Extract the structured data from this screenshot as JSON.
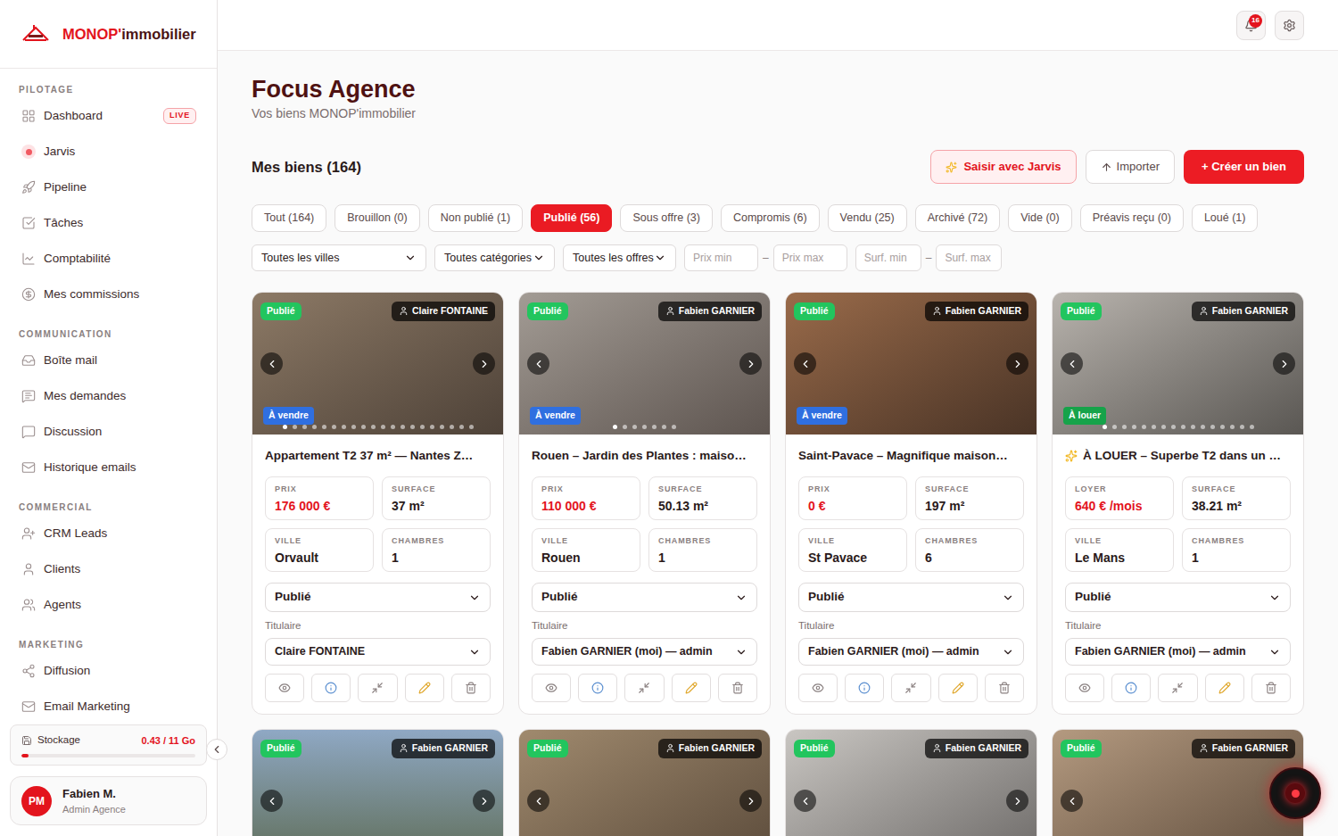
{
  "sidebar": {
    "logo": {
      "brand": "MONOP'",
      "suffix": "immobilier"
    },
    "sections": [
      {
        "label": "PILOTAGE",
        "items": [
          {
            "label": "Dashboard",
            "badge": "LIVE",
            "selected": false
          },
          {
            "label": "Jarvis",
            "badge": "",
            "selected": false
          },
          {
            "label": "Pipeline",
            "badge": "",
            "selected": false
          },
          {
            "label": "Tâches",
            "badge": "",
            "selected": false
          },
          {
            "label": "Comptabilité",
            "badge": "",
            "selected": false
          },
          {
            "label": "Mes commissions",
            "badge": "",
            "selected": false
          }
        ]
      },
      {
        "label": "COMMUNICATION",
        "items": [
          {
            "label": "Boîte mail",
            "badge": "",
            "selected": false
          },
          {
            "label": "Mes demandes",
            "badge": "",
            "selected": false
          },
          {
            "label": "Discussion",
            "badge": "",
            "selected": false
          },
          {
            "label": "Historique emails",
            "badge": "",
            "selected": false
          }
        ]
      },
      {
        "label": "COMMERCIAL",
        "items": [
          {
            "label": "CRM Leads",
            "badge": "",
            "selected": false
          },
          {
            "label": "Clients",
            "badge": "",
            "selected": false
          },
          {
            "label": "Agents",
            "badge": "",
            "selected": false
          }
        ]
      },
      {
        "label": "MARKETING",
        "items": [
          {
            "label": "Diffusion",
            "badge": "",
            "selected": false
          },
          {
            "label": "Email Marketing",
            "badge": "",
            "selected": false
          }
        ]
      }
    ],
    "storage": {
      "label": "Stockage",
      "reading": "0.43 / 11 Go",
      "level": 0.04
    },
    "user": {
      "initials": "PM",
      "name": "Fabien M.",
      "role": "Admin Agence"
    }
  },
  "topbar": {
    "notifications": "16"
  },
  "page": {
    "title": "Focus Agence",
    "subtitle": "Vos biens MONOP'immobilier"
  },
  "listing": {
    "heading": "Mes biens (164)",
    "actions": [
      {
        "label": "Saisir avec Jarvis",
        "kind": "jarvis"
      },
      {
        "label": "Importer",
        "kind": "import"
      },
      {
        "label": "+ Créer un bien",
        "kind": "create"
      }
    ]
  },
  "tabs": [
    {
      "label": "Tout (164)",
      "selected": false
    },
    {
      "label": "Brouillon (0)",
      "selected": false
    },
    {
      "label": "Non publié (1)",
      "selected": false
    },
    {
      "label": "Publié (56)",
      "selected": true
    },
    {
      "label": "Sous offre (3)",
      "selected": false
    },
    {
      "label": "Compromis (6)",
      "selected": false
    },
    {
      "label": "Vendu (25)",
      "selected": false
    },
    {
      "label": "Archivé (72)",
      "selected": false
    },
    {
      "label": "Vide (0)",
      "selected": false
    },
    {
      "label": "Préavis reçu (0)",
      "selected": false
    },
    {
      "label": "Loué (1)",
      "selected": false
    }
  ],
  "filters": {
    "selects": [
      "Toutes les villes",
      "Toutes catégories",
      "Toutes les offres"
    ],
    "ranges": [
      {
        "min": "Prix min",
        "separator": "–",
        "max": "Prix max"
      },
      {
        "min": "Surf. min",
        "separator": "–",
        "max": "Surf. max"
      }
    ]
  },
  "cards": [
    {
      "status": "Publié",
      "agent": "Claire FONTAINE",
      "offer": "À vendre",
      "offer_color": "#2f6fe0",
      "slides": 20,
      "current_slide": 0,
      "featured": false,
      "title": "Appartement T2 37 m² — Nantes Z…",
      "stats": [
        {
          "label": "PRIX",
          "value": "176 000 €",
          "kind": "price"
        },
        {
          "label": "SURFACE",
          "value": "37 m²",
          "kind": "plain"
        },
        {
          "label": "VILLE",
          "value": "Orvault",
          "kind": "plain"
        },
        {
          "label": "CHAMBRES",
          "value": "1",
          "kind": "plain"
        }
      ],
      "status_select": "Publié",
      "titulaire_label": "Titulaire",
      "titulaire": "Claire FONTAINE"
    },
    {
      "status": "Publié",
      "agent": "Fabien GARNIER",
      "offer": "À vendre",
      "offer_color": "#2f6fe0",
      "slides": 7,
      "current_slide": 0,
      "featured": false,
      "title": "Rouen – Jardin des Plantes : maiso…",
      "stats": [
        {
          "label": "PRIX",
          "value": "110 000 €",
          "kind": "price"
        },
        {
          "label": "SURFACE",
          "value": "50.13 m²",
          "kind": "plain"
        },
        {
          "label": "VILLE",
          "value": "Rouen",
          "kind": "plain"
        },
        {
          "label": "CHAMBRES",
          "value": "1",
          "kind": "plain"
        }
      ],
      "status_select": "Publié",
      "titulaire_label": "Titulaire",
      "titulaire": "Fabien GARNIER (moi) — admin"
    },
    {
      "status": "Publié",
      "agent": "Fabien GARNIER",
      "offer": "À vendre",
      "offer_color": "#2f6fe0",
      "slides": 0,
      "current_slide": 0,
      "featured": false,
      "title": "Saint-Pavace – Magnifique maison…",
      "stats": [
        {
          "label": "PRIX",
          "value": "0 €",
          "kind": "price"
        },
        {
          "label": "SURFACE",
          "value": "197 m²",
          "kind": "plain"
        },
        {
          "label": "VILLE",
          "value": "St Pavace",
          "kind": "plain"
        },
        {
          "label": "CHAMBRES",
          "value": "6",
          "kind": "plain"
        }
      ],
      "status_select": "Publié",
      "titulaire_label": "Titulaire",
      "titulaire": "Fabien GARNIER (moi) — admin"
    },
    {
      "status": "Publié",
      "agent": "Fabien GARNIER",
      "offer": "À louer",
      "offer_color": "#16a34a",
      "slides": 16,
      "current_slide": 0,
      "featured": true,
      "title": "À LOUER – Superbe T2 dans un …",
      "stats": [
        {
          "label": "LOYER",
          "value": "640 € /mois",
          "kind": "price"
        },
        {
          "label": "SURFACE",
          "value": "38.21 m²",
          "kind": "plain"
        },
        {
          "label": "VILLE",
          "value": "Le Mans",
          "kind": "plain"
        },
        {
          "label": "CHAMBRES",
          "value": "1",
          "kind": "plain"
        }
      ],
      "status_select": "Publié",
      "titulaire_label": "Titulaire",
      "titulaire": "Fabien GARNIER (moi) — admin"
    }
  ],
  "more_cards": [
    {
      "status": "Publié",
      "agent": "Fabien GARNIER"
    },
    {
      "status": "Publié",
      "agent": "Fabien GARNIER"
    },
    {
      "status": "Publié",
      "agent": "Fabien GARNIER"
    },
    {
      "status": "Publié",
      "agent": "Fabien GARNIER"
    }
  ]
}
